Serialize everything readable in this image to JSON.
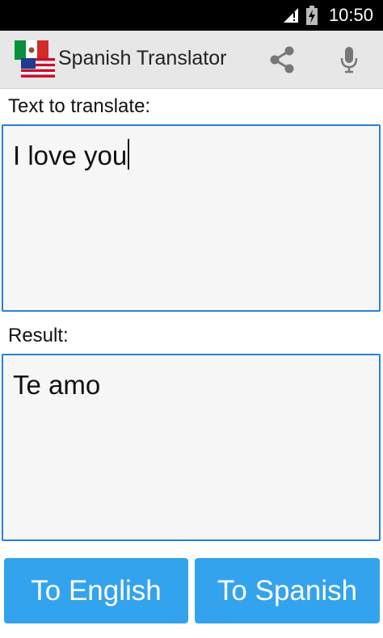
{
  "status_bar": {
    "time": "10:50"
  },
  "app": {
    "title": "Spanish Translator"
  },
  "input": {
    "label": "Text to translate:",
    "value": "I love you"
  },
  "result": {
    "label": "Result:",
    "value": "Te amo"
  },
  "buttons": {
    "to_english": "To English",
    "to_spanish": "To Spanish"
  },
  "icons": {
    "share": "share-icon",
    "mic": "microphone-icon",
    "flags": [
      "mexico-flag-icon",
      "usa-flag-icon"
    ],
    "signal": "signal-icon",
    "battery": "battery-charging-icon"
  },
  "colors": {
    "accent_button": "#33a3ee",
    "field_border": "#2c7fd6",
    "action_bar": "#e7e7e7"
  }
}
